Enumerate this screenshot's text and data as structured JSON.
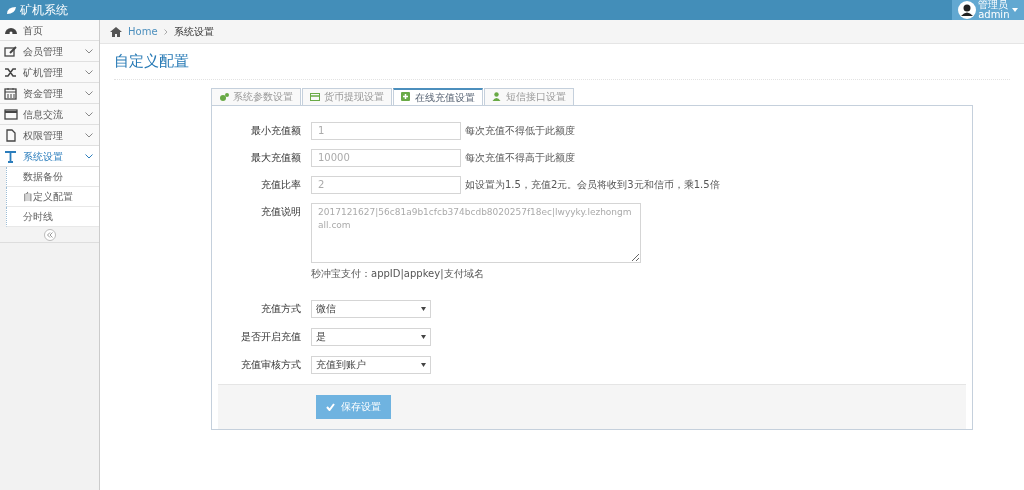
{
  "navbar": {
    "brand": "矿机系统",
    "user": {
      "role": "管理员",
      "name": "admin"
    }
  },
  "sidebar": {
    "items": [
      {
        "label": "首页",
        "has_arrow": false,
        "selected": false
      },
      {
        "label": "会员管理",
        "has_arrow": true,
        "selected": false
      },
      {
        "label": "矿机管理",
        "has_arrow": true,
        "selected": false
      },
      {
        "label": "资金管理",
        "has_arrow": true,
        "selected": false
      },
      {
        "label": "信息交流",
        "has_arrow": true,
        "selected": false
      },
      {
        "label": "权限管理",
        "has_arrow": true,
        "selected": false
      },
      {
        "label": "系统设置",
        "has_arrow": true,
        "selected": true,
        "children": [
          {
            "label": "数据备份"
          },
          {
            "label": "自定义配置"
          },
          {
            "label": "分时线"
          }
        ]
      }
    ]
  },
  "breadcrumb": [
    "Home",
    "系统设置"
  ],
  "page_title": "自定义配置",
  "tabs": [
    {
      "label": "系统参数设置",
      "selected": false
    },
    {
      "label": "货币提现设置",
      "selected": false
    },
    {
      "label": "在线充值设置",
      "selected": true
    },
    {
      "label": "短信接口设置",
      "selected": false
    }
  ],
  "form": {
    "fields": [
      {
        "kind": "input",
        "label": "最小充值额",
        "placeholder": "1",
        "help": "每次充值不得低于此额度"
      },
      {
        "kind": "input",
        "label": "最大充值额",
        "placeholder": "10000",
        "help": "每次充值不得高于此额度"
      },
      {
        "kind": "input",
        "label": "充值比率",
        "placeholder": "2",
        "help": "如设置为1.5，充值2元。会员将收到3元和信币，乘1.5倍"
      },
      {
        "kind": "textarea",
        "label": "充值说明",
        "placeholder": "2017121627|56c81a9b1cfcb374bcdb8020257f18ec|lwyyky.lezhongmall.com",
        "help": "秒冲宝支付：appID|appkey|支付域名"
      },
      {
        "kind": "select",
        "label": "充值方式",
        "value": "微信"
      },
      {
        "kind": "select",
        "label": "是否开启充值",
        "value": "是"
      },
      {
        "kind": "select",
        "label": "充值审核方式",
        "value": "充值到账户"
      }
    ],
    "submit": "保存设置"
  }
}
